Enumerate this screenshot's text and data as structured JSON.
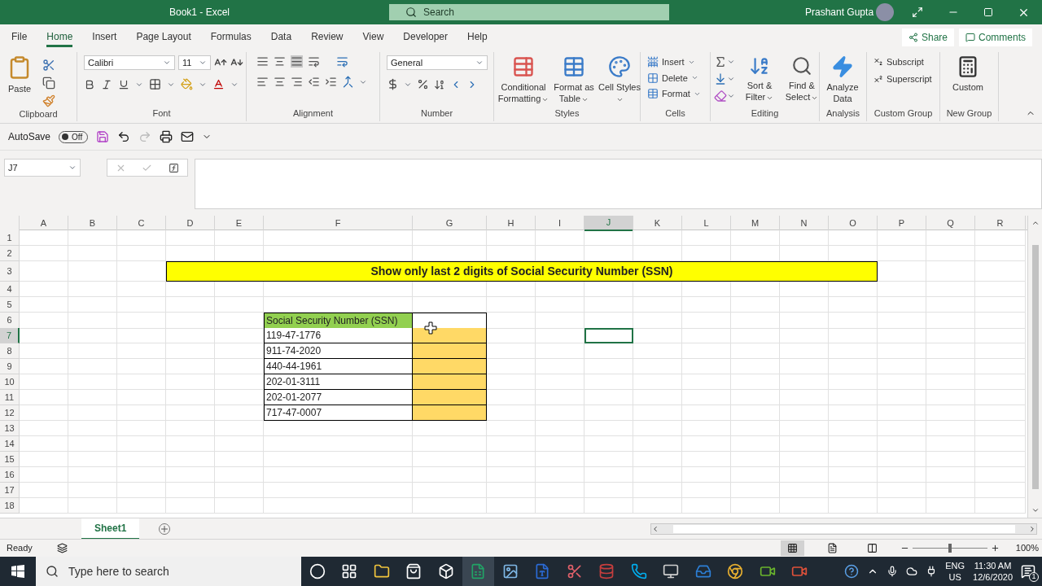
{
  "window": {
    "title": "Book1  -  Excel",
    "search": "Search",
    "user": "Prashant Gupta"
  },
  "menu_tabs": [
    {
      "label": "File",
      "selected": false
    },
    {
      "label": "Home",
      "selected": true
    },
    {
      "label": "Insert",
      "selected": false
    },
    {
      "label": "Page Layout",
      "selected": false
    },
    {
      "label": "Formulas",
      "selected": false
    },
    {
      "label": "Data",
      "selected": false
    },
    {
      "label": "Review",
      "selected": false
    },
    {
      "label": "View",
      "selected": false
    },
    {
      "label": "Developer",
      "selected": false
    },
    {
      "label": "Help",
      "selected": false
    }
  ],
  "share": "Share",
  "comments": "Comments",
  "ribbon_groups": [
    {
      "kind": "clipboard",
      "label": "Clipboard",
      "button": "Paste"
    },
    {
      "kind": "font",
      "label": "Font",
      "font": "Calibri",
      "size": "11"
    },
    {
      "kind": "alignment",
      "label": "Alignment"
    },
    {
      "kind": "number",
      "label": "Number",
      "format": "General"
    },
    {
      "kind": "styles",
      "label": "Styles",
      "buttons": [
        "Conditional Formatting",
        "Format as Table",
        "Cell Styles"
      ]
    },
    {
      "kind": "cells",
      "label": "Cells",
      "buttons": [
        "Insert",
        "Delete",
        "Format"
      ]
    },
    {
      "kind": "editing",
      "label": "Editing",
      "buttons": [
        "Sort & Filter",
        "Find & Select"
      ]
    },
    {
      "kind": "analysis",
      "label": "Analysis",
      "button": "Analyze Data"
    },
    {
      "kind": "custom",
      "label": "Custom Group",
      "buttons": [
        "Subscript",
        "Superscript"
      ]
    },
    {
      "kind": "newgroup",
      "label": "New Group",
      "button": "Custom"
    }
  ],
  "quick_access": {
    "autosave": "AutoSave",
    "toggle": {
      "label": "Off",
      "on": false
    }
  },
  "formula_bar": {
    "name_box": "J7"
  },
  "sheet": {
    "columns": [
      {
        "label": "A",
        "selected": false
      },
      {
        "label": "B",
        "selected": false
      },
      {
        "label": "C",
        "selected": false
      },
      {
        "label": "D",
        "selected": false
      },
      {
        "label": "E",
        "selected": false
      },
      {
        "label": "F",
        "selected": false
      },
      {
        "label": "G",
        "selected": false
      },
      {
        "label": "H",
        "selected": false
      },
      {
        "label": "I",
        "selected": false
      },
      {
        "label": "J",
        "selected": true
      },
      {
        "label": "K",
        "selected": false
      },
      {
        "label": "L",
        "selected": false
      },
      {
        "label": "M",
        "selected": false
      },
      {
        "label": "N",
        "selected": false
      },
      {
        "label": "O",
        "selected": false
      },
      {
        "label": "P",
        "selected": false
      },
      {
        "label": "Q",
        "selected": false
      },
      {
        "label": "R",
        "selected": false
      }
    ],
    "rows": [
      {
        "label": "1",
        "selected": false
      },
      {
        "label": "2",
        "selected": false
      },
      {
        "label": "3",
        "selected": false
      },
      {
        "label": "4",
        "selected": false
      },
      {
        "label": "5",
        "selected": false
      },
      {
        "label": "6",
        "selected": false
      },
      {
        "label": "7",
        "selected": true
      },
      {
        "label": "8",
        "selected": false
      },
      {
        "label": "9",
        "selected": false
      },
      {
        "label": "10",
        "selected": false
      },
      {
        "label": "11",
        "selected": false
      },
      {
        "label": "12",
        "selected": false
      },
      {
        "label": "13",
        "selected": false
      },
      {
        "label": "14",
        "selected": false
      },
      {
        "label": "15",
        "selected": false
      },
      {
        "label": "16",
        "selected": false
      },
      {
        "label": "17",
        "selected": false
      },
      {
        "label": "18",
        "selected": false
      }
    ],
    "banner": "Show only last 2 digits of Social Security Number (SSN)",
    "table": {
      "header": "Social Security Number (SSN)",
      "values": [
        "119-47-1776",
        "911-74-2020",
        "440-44-1961",
        "202-01-3111",
        "202-01-2077",
        "717-47-0007"
      ]
    }
  },
  "sheet_tabs": [
    {
      "label": "Sheet1",
      "selected": true
    }
  ],
  "status": {
    "mode": "Ready",
    "zoom": "100%"
  },
  "zoom_slider": {
    "level": 0.5
  },
  "view_buttons": [
    {
      "kind": "normal",
      "selected": true
    },
    {
      "kind": "page_layout",
      "selected": false
    },
    {
      "kind": "page_break",
      "selected": false
    }
  ],
  "taskbar": {
    "search": "Type here to search",
    "language": "ENG",
    "region": "US",
    "time": "11:30 AM",
    "date": "12/6/2020",
    "notifications": "1"
  }
}
